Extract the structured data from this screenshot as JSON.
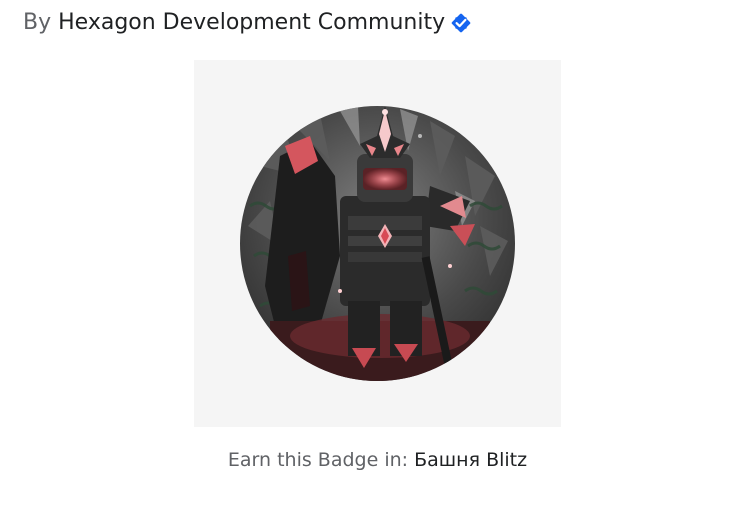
{
  "creator": {
    "prefix": "By",
    "name": "Hexagon Development Community",
    "verified_icon": "verified-check-icon",
    "verified_color": "#1565f0"
  },
  "badge": {
    "image_icon": "badge-armored-knight-image",
    "frame_color": "#f5f5f5",
    "accent_color": "#d8505a"
  },
  "earn": {
    "prefix": "Earn this Badge in:",
    "experience": "Башня Blitz"
  }
}
